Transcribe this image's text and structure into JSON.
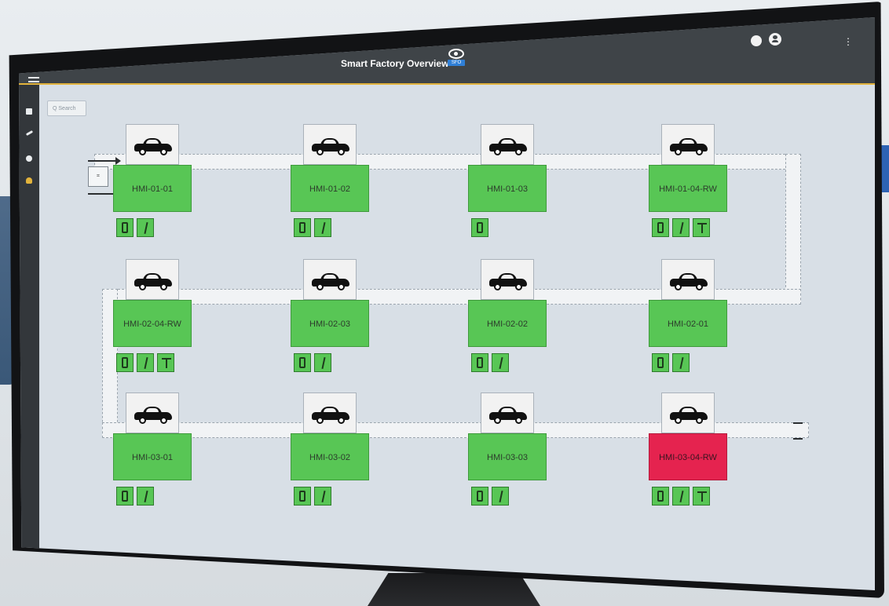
{
  "app": {
    "title": "Smart Factory Overview",
    "logo_badge": "SFO"
  },
  "header": {
    "menu_icon": "hamburger-icon",
    "status_icon": "status-circle-icon",
    "user_icon": "user-account-icon",
    "more_icon": "kebab-menu-icon"
  },
  "sidebar": {
    "items": [
      {
        "icon": "dashboard-icon"
      },
      {
        "icon": "edit-icon"
      },
      {
        "icon": "location-icon"
      },
      {
        "icon": "factory-icon"
      }
    ]
  },
  "search": {
    "placeholder": "Q Search"
  },
  "colors": {
    "ok": "#58c655",
    "alert": "#e5234f",
    "topbar": "#3f4448",
    "accent": "#e2b33c"
  },
  "stations": [
    {
      "id": "HMI-01-01",
      "status": "ok",
      "tools": [
        "door",
        "wrench"
      ]
    },
    {
      "id": "HMI-01-02",
      "status": "ok",
      "tools": [
        "door",
        "wrench"
      ]
    },
    {
      "id": "HMI-01-03",
      "status": "ok",
      "tools": [
        "door"
      ]
    },
    {
      "id": "HMI-01-04-RW",
      "status": "ok",
      "tools": [
        "door",
        "wrench",
        "welder"
      ]
    },
    {
      "id": "HMI-02-04-RW",
      "status": "ok",
      "tools": [
        "door",
        "wrench",
        "welder"
      ]
    },
    {
      "id": "HMI-02-03",
      "status": "ok",
      "tools": [
        "door",
        "wrench"
      ]
    },
    {
      "id": "HMI-02-02",
      "status": "ok",
      "tools": [
        "door",
        "wrench"
      ]
    },
    {
      "id": "HMI-02-01",
      "status": "ok",
      "tools": [
        "door",
        "wrench"
      ]
    },
    {
      "id": "HMI-03-01",
      "status": "ok",
      "tools": [
        "door",
        "wrench"
      ]
    },
    {
      "id": "HMI-03-02",
      "status": "ok",
      "tools": [
        "door",
        "wrench"
      ]
    },
    {
      "id": "HMI-03-03",
      "status": "ok",
      "tools": [
        "door",
        "wrench"
      ]
    },
    {
      "id": "HMI-03-04-RW",
      "status": "alert",
      "tools": [
        "door",
        "wrench",
        "welder"
      ]
    }
  ]
}
